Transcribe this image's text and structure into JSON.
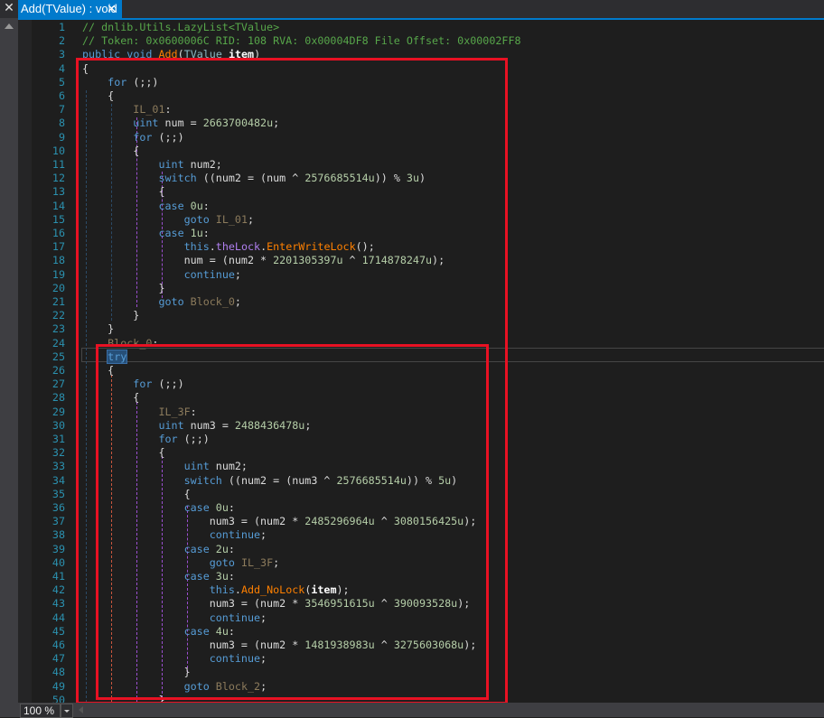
{
  "tab": {
    "title": "Add(TValue) : void",
    "close": "✕"
  },
  "left_strip": {
    "close": "✕"
  },
  "status": {
    "zoom": "100 %"
  },
  "colors": {
    "accent": "#007acc",
    "highlight_box": "#e81123",
    "keyword": "#569cd6",
    "comment": "#57a64a",
    "method": "#ff8000",
    "field": "#b07ff0",
    "number": "#b5cea8",
    "label": "#8c7b5c"
  },
  "code": [
    [
      [
        "c",
        "// dnlib.Utils.LazyList<TValue>"
      ]
    ],
    [
      [
        "c",
        "// Token: 0x0600006C RID: 108 RVA: 0x00004DF8 File Offset: 0x00002FF8"
      ]
    ],
    [
      [
        "k",
        "public"
      ],
      [
        "p",
        " "
      ],
      [
        "k",
        "void"
      ],
      [
        "p",
        " "
      ],
      [
        "m",
        "Add"
      ],
      [
        "p",
        "("
      ],
      [
        "t",
        "TValue"
      ],
      [
        "p",
        " "
      ],
      [
        "a",
        "item"
      ],
      [
        "p",
        ")"
      ]
    ],
    [
      [
        "p",
        "{"
      ]
    ],
    [
      [
        "p",
        "    "
      ],
      [
        "k",
        "for"
      ],
      [
        "p",
        " (;;)"
      ]
    ],
    [
      [
        "p",
        "    {"
      ]
    ],
    [
      [
        "p",
        "        "
      ],
      [
        "l",
        "IL_01"
      ],
      [
        "p",
        ":"
      ]
    ],
    [
      [
        "p",
        "        "
      ],
      [
        "k",
        "uint"
      ],
      [
        "p",
        " num = "
      ],
      [
        "n",
        "2663700482u"
      ],
      [
        "p",
        ";"
      ]
    ],
    [
      [
        "p",
        "        "
      ],
      [
        "k",
        "for"
      ],
      [
        "p",
        " (;;)"
      ]
    ],
    [
      [
        "p",
        "        {"
      ]
    ],
    [
      [
        "p",
        "            "
      ],
      [
        "k",
        "uint"
      ],
      [
        "p",
        " num2;"
      ]
    ],
    [
      [
        "p",
        "            "
      ],
      [
        "k",
        "switch"
      ],
      [
        "p",
        " ((num2 = (num ^ "
      ],
      [
        "n",
        "2576685514u"
      ],
      [
        "p",
        ")) % "
      ],
      [
        "n",
        "3u"
      ],
      [
        "p",
        ")"
      ]
    ],
    [
      [
        "p",
        "            {"
      ]
    ],
    [
      [
        "p",
        "            "
      ],
      [
        "k",
        "case"
      ],
      [
        "p",
        " "
      ],
      [
        "n",
        "0u"
      ],
      [
        "p",
        ":"
      ]
    ],
    [
      [
        "p",
        "                "
      ],
      [
        "k",
        "goto"
      ],
      [
        "p",
        " "
      ],
      [
        "l",
        "IL_01"
      ],
      [
        "p",
        ";"
      ]
    ],
    [
      [
        "p",
        "            "
      ],
      [
        "k",
        "case"
      ],
      [
        "p",
        " "
      ],
      [
        "n",
        "1u"
      ],
      [
        "p",
        ":"
      ]
    ],
    [
      [
        "p",
        "                "
      ],
      [
        "k",
        "this"
      ],
      [
        "p",
        "."
      ],
      [
        "f",
        "theLock"
      ],
      [
        "p",
        "."
      ],
      [
        "m",
        "EnterWriteLock"
      ],
      [
        "p",
        "();"
      ]
    ],
    [
      [
        "p",
        "                num = (num2 * "
      ],
      [
        "n",
        "2201305397u"
      ],
      [
        "p",
        " ^ "
      ],
      [
        "n",
        "1714878247u"
      ],
      [
        "p",
        ");"
      ]
    ],
    [
      [
        "p",
        "                "
      ],
      [
        "k",
        "continue"
      ],
      [
        "p",
        ";"
      ]
    ],
    [
      [
        "p",
        "            }"
      ]
    ],
    [
      [
        "p",
        "            "
      ],
      [
        "k",
        "goto"
      ],
      [
        "p",
        " "
      ],
      [
        "l",
        "Block_0"
      ],
      [
        "p",
        ";"
      ]
    ],
    [
      [
        "p",
        "        }"
      ]
    ],
    [
      [
        "p",
        "    }"
      ]
    ],
    [
      [
        "p",
        "    "
      ],
      [
        "l",
        "Block_0"
      ],
      [
        "p",
        ":"
      ]
    ],
    [
      [
        "p",
        "    "
      ],
      [
        "sel",
        "try"
      ]
    ],
    [
      [
        "p",
        "    {"
      ]
    ],
    [
      [
        "p",
        "        "
      ],
      [
        "k",
        "for"
      ],
      [
        "p",
        " (;;)"
      ]
    ],
    [
      [
        "p",
        "        {"
      ]
    ],
    [
      [
        "p",
        "            "
      ],
      [
        "l",
        "IL_3F"
      ],
      [
        "p",
        ":"
      ]
    ],
    [
      [
        "p",
        "            "
      ],
      [
        "k",
        "uint"
      ],
      [
        "p",
        " num3 = "
      ],
      [
        "n",
        "2488436478u"
      ],
      [
        "p",
        ";"
      ]
    ],
    [
      [
        "p",
        "            "
      ],
      [
        "k",
        "for"
      ],
      [
        "p",
        " (;;)"
      ]
    ],
    [
      [
        "p",
        "            {"
      ]
    ],
    [
      [
        "p",
        "                "
      ],
      [
        "k",
        "uint"
      ],
      [
        "p",
        " num2;"
      ]
    ],
    [
      [
        "p",
        "                "
      ],
      [
        "k",
        "switch"
      ],
      [
        "p",
        " ((num2 = (num3 ^ "
      ],
      [
        "n",
        "2576685514u"
      ],
      [
        "p",
        ")) % "
      ],
      [
        "n",
        "5u"
      ],
      [
        "p",
        ")"
      ]
    ],
    [
      [
        "p",
        "                {"
      ]
    ],
    [
      [
        "p",
        "                "
      ],
      [
        "k",
        "case"
      ],
      [
        "p",
        " "
      ],
      [
        "n",
        "0u"
      ],
      [
        "p",
        ":"
      ]
    ],
    [
      [
        "p",
        "                    num3 = (num2 * "
      ],
      [
        "n",
        "2485296964u"
      ],
      [
        "p",
        " ^ "
      ],
      [
        "n",
        "3080156425u"
      ],
      [
        "p",
        ");"
      ]
    ],
    [
      [
        "p",
        "                    "
      ],
      [
        "k",
        "continue"
      ],
      [
        "p",
        ";"
      ]
    ],
    [
      [
        "p",
        "                "
      ],
      [
        "k",
        "case"
      ],
      [
        "p",
        " "
      ],
      [
        "n",
        "2u"
      ],
      [
        "p",
        ":"
      ]
    ],
    [
      [
        "p",
        "                    "
      ],
      [
        "k",
        "goto"
      ],
      [
        "p",
        " "
      ],
      [
        "l",
        "IL_3F"
      ],
      [
        "p",
        ";"
      ]
    ],
    [
      [
        "p",
        "                "
      ],
      [
        "k",
        "case"
      ],
      [
        "p",
        " "
      ],
      [
        "n",
        "3u"
      ],
      [
        "p",
        ":"
      ]
    ],
    [
      [
        "p",
        "                    "
      ],
      [
        "k",
        "this"
      ],
      [
        "p",
        "."
      ],
      [
        "m",
        "Add_NoLock"
      ],
      [
        "p",
        "("
      ],
      [
        "a",
        "item"
      ],
      [
        "p",
        ");"
      ]
    ],
    [
      [
        "p",
        "                    num3 = (num2 * "
      ],
      [
        "n",
        "3546951615u"
      ],
      [
        "p",
        " ^ "
      ],
      [
        "n",
        "390093528u"
      ],
      [
        "p",
        ");"
      ]
    ],
    [
      [
        "p",
        "                    "
      ],
      [
        "k",
        "continue"
      ],
      [
        "p",
        ";"
      ]
    ],
    [
      [
        "p",
        "                "
      ],
      [
        "k",
        "case"
      ],
      [
        "p",
        " "
      ],
      [
        "n",
        "4u"
      ],
      [
        "p",
        ":"
      ]
    ],
    [
      [
        "p",
        "                    num3 = (num2 * "
      ],
      [
        "n",
        "1481938983u"
      ],
      [
        "p",
        " ^ "
      ],
      [
        "n",
        "3275603068u"
      ],
      [
        "p",
        ");"
      ]
    ],
    [
      [
        "p",
        "                    "
      ],
      [
        "k",
        "continue"
      ],
      [
        "p",
        ";"
      ]
    ],
    [
      [
        "p",
        "                }"
      ]
    ],
    [
      [
        "p",
        "                "
      ],
      [
        "k",
        "goto"
      ],
      [
        "p",
        " "
      ],
      [
        "l",
        "Block_2"
      ],
      [
        "p",
        ";"
      ]
    ],
    [
      [
        "p",
        "            }"
      ]
    ]
  ]
}
